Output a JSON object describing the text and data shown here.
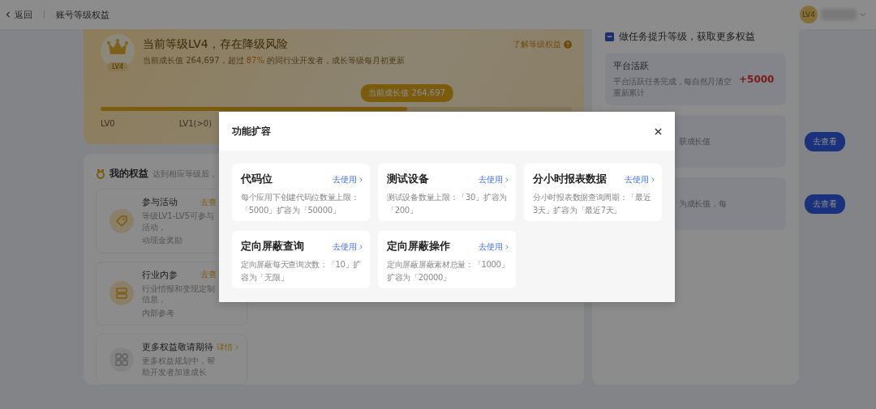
{
  "header": {
    "back": "返回",
    "title": "账号等级权益",
    "avatar": "LV4"
  },
  "level_card": {
    "badge": "LV4",
    "title": "当前等级LV4，存在降级风险",
    "subtitle": "当前成长值 264,697，超过 **87%** 的同行业开发者，成长等级每月初更新",
    "help_link": "了解等级权益",
    "tooltip": "当前成长值 264,697",
    "progress": {
      "level": 0.65
    },
    "ticks": [
      "LV0",
      "LV1(>0)"
    ]
  },
  "rights": {
    "title": "我的权益",
    "hint": "达到相应等级后，",
    "items": [
      {
        "kind": "tag",
        "title": "参与活动",
        "link": "去查",
        "desc": [
          "等级LV1-LV5可参与活动，",
          "动现金奖励"
        ]
      },
      {
        "kind": "book",
        "title": "行业内参",
        "link": "去查",
        "desc": [
          "行业情报和变现定制信息，",
          "内部参考"
        ]
      },
      {
        "kind": "grid",
        "title": "更多权益敬请期待",
        "link": "详情",
        "desc": [
          "更多权益规划中，帮助开发者加速成长"
        ]
      }
    ]
  },
  "tasks": {
    "title": "做任务提升等级，获取更多权益",
    "items": [
      {
        "kind": "reward",
        "title": "平台活跃",
        "desc": "平台活跃任务完成，每自然月清空重新累计",
        "reward": "+5000"
      },
      {
        "kind": "button",
        "desc": "获成长值",
        "button": "去查看"
      },
      {
        "kind": "button",
        "desc": "为成长值，每",
        "button": "去查看"
      }
    ]
  },
  "modal": {
    "title": "功能扩容",
    "cards": [
      {
        "title": "代码位",
        "link": "去使用",
        "desc": "每个应用下创建代码位数量上限：「5000」扩容为「50000」"
      },
      {
        "title": "测试设备",
        "link": "去使用",
        "desc": "测试设备数量上限：「30」扩容为「200」"
      },
      {
        "title": "分小时报表数据",
        "link": "去使用",
        "desc": "分小时报表数据查询周期：「最近3天」扩容为「最近7天」"
      },
      {
        "title": "定向屏蔽查询",
        "link": "去使用",
        "desc": "定向屏蔽每天查询次数：「10」扩容为「无限」"
      },
      {
        "title": "定向屏蔽操作",
        "link": "去使用",
        "desc": "定向屏蔽屏蔽素材总量：「1000」扩容为「20000」"
      }
    ]
  }
}
